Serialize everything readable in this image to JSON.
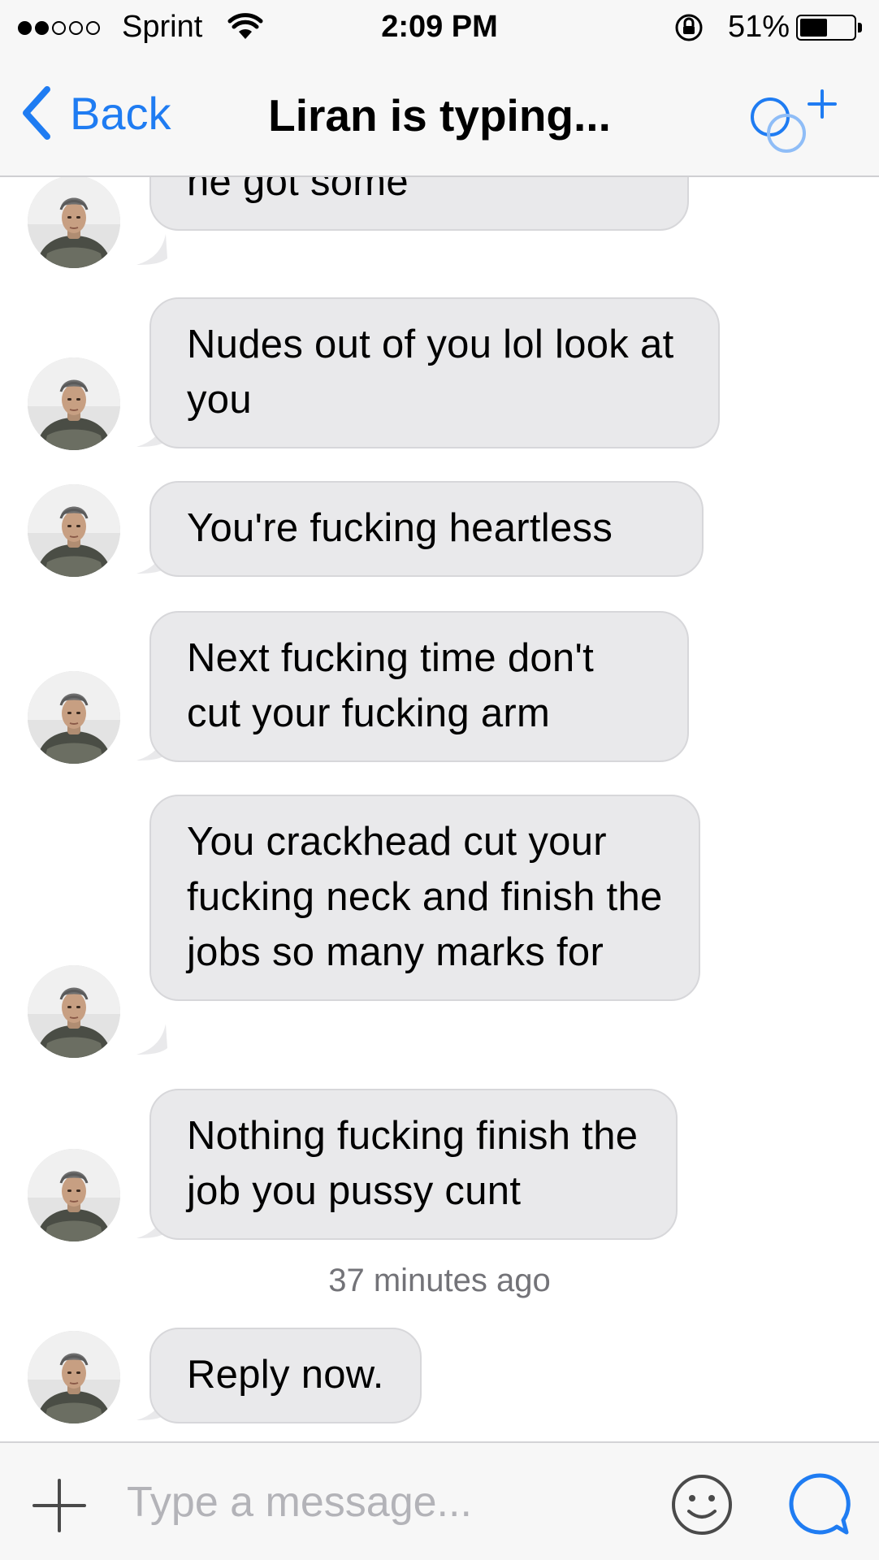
{
  "status_bar": {
    "carrier": "Sprint",
    "time": "2:09 PM",
    "battery_percent": "51%",
    "battery_level": 0.51,
    "signal_strength_bars": 2,
    "signal_total_bars": 5
  },
  "nav": {
    "back_label": "Back",
    "title": "Liran is typing...",
    "accent_color": "#1f7cf2"
  },
  "messages": [
    {
      "text": "like you were trash and he got some",
      "partially_hidden": true
    },
    {
      "text": "Nudes out of you lol look at you"
    },
    {
      "text": "You're fucking heartless"
    },
    {
      "text": "Next fucking time don't cut your fucking arm"
    },
    {
      "text": "You crackhead cut your fucking neck and finish the jobs so many marks for"
    },
    {
      "text": "Nothing fucking finish the job you pussy cunt"
    },
    {
      "text": "Reply now."
    }
  ],
  "timestamp": "37 minutes ago",
  "composer": {
    "placeholder": "Type a message..."
  },
  "icons": {
    "back": "chevron-left-icon",
    "add_people": "add-people-icon",
    "plus": "plus-icon",
    "emoji": "smiley-icon",
    "send": "chat-bubble-icon"
  }
}
